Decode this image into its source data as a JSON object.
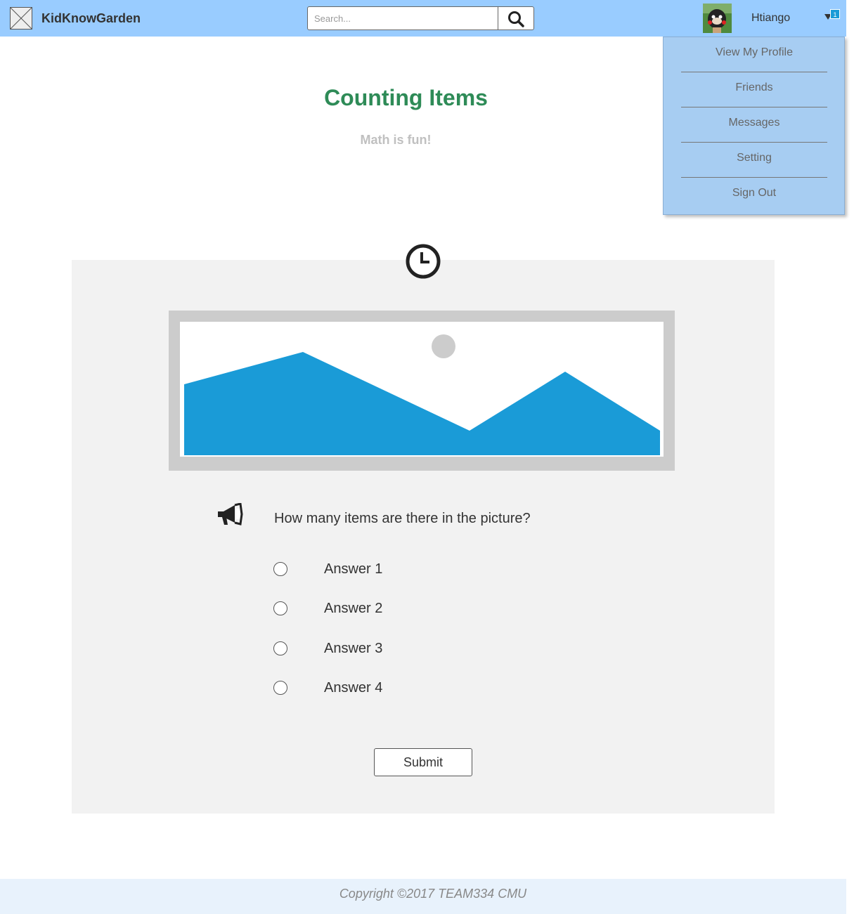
{
  "header": {
    "brand": "KidKnowGarden",
    "search_placeholder": "Search...",
    "username": "Htiango",
    "notification_count": "1"
  },
  "menu": {
    "items": [
      "View My Profile",
      "Friends",
      "Messages",
      "Setting",
      "Sign Out"
    ]
  },
  "page": {
    "title": "Counting Items",
    "subtitle": "Math is fun!"
  },
  "quiz": {
    "question": "How many items are there in the picture?",
    "answers": [
      "Answer 1",
      "Answer 2",
      "Answer 3",
      "Answer 4"
    ],
    "submit_label": "Submit"
  },
  "footer": {
    "copyright": "Copyright ©2017 TEAM334 CMU"
  },
  "icons": [
    "image-placeholder-icon",
    "search-icon",
    "caret-down-icon",
    "clock-icon",
    "picture-placeholder-icon",
    "megaphone-icon"
  ],
  "colors": {
    "header_bg": "#99ccff",
    "menu_bg": "#a7cdf2",
    "title": "#2e8b57",
    "badge": "#1a9bd7",
    "image_mountain": "#1a9bd7"
  }
}
